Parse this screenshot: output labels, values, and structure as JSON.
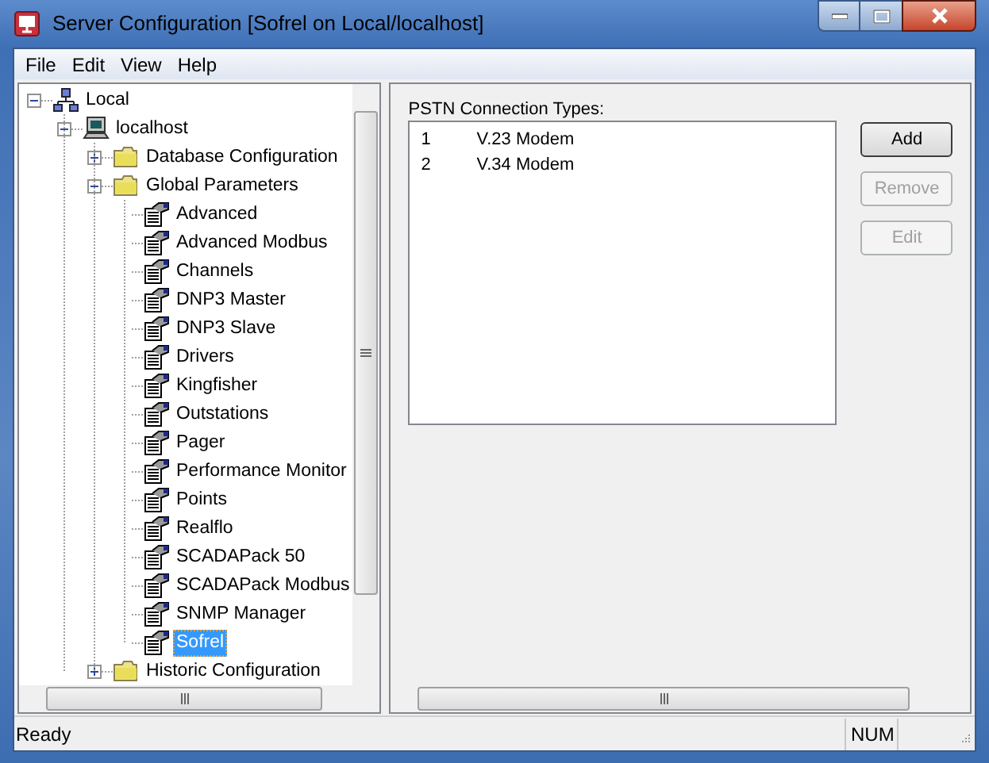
{
  "window": {
    "title": "Server Configuration [Sofrel on Local/localhost]"
  },
  "menu": [
    "File",
    "Edit",
    "View",
    "Help"
  ],
  "tree": [
    {
      "label": "Local",
      "kind": "network",
      "expanded": true,
      "selected": false,
      "children": [
        {
          "label": "localhost",
          "kind": "computer",
          "expanded": true,
          "selected": false,
          "children": [
            {
              "label": "Database Configuration",
              "kind": "folder",
              "expanded": false,
              "selected": false
            },
            {
              "label": "Global Parameters",
              "kind": "folder",
              "expanded": true,
              "selected": false,
              "children": [
                {
                  "label": "Advanced",
                  "kind": "page",
                  "selected": false
                },
                {
                  "label": "Advanced Modbus",
                  "kind": "page",
                  "selected": false
                },
                {
                  "label": "Channels",
                  "kind": "page",
                  "selected": false
                },
                {
                  "label": "DNP3 Master",
                  "kind": "page",
                  "selected": false
                },
                {
                  "label": "DNP3 Slave",
                  "kind": "page",
                  "selected": false
                },
                {
                  "label": "Drivers",
                  "kind": "page",
                  "selected": false
                },
                {
                  "label": "Kingfisher",
                  "kind": "page",
                  "selected": false
                },
                {
                  "label": "Outstations",
                  "kind": "page",
                  "selected": false
                },
                {
                  "label": "Pager",
                  "kind": "page",
                  "selected": false
                },
                {
                  "label": "Performance Monitor",
                  "kind": "page",
                  "selected": false
                },
                {
                  "label": "Points",
                  "kind": "page",
                  "selected": false
                },
                {
                  "label": "Realflo",
                  "kind": "page",
                  "selected": false
                },
                {
                  "label": "SCADAPack 50",
                  "kind": "page",
                  "selected": false
                },
                {
                  "label": "SCADAPack Modbus",
                  "kind": "page",
                  "selected": false
                },
                {
                  "label": "SNMP Manager",
                  "kind": "page",
                  "selected": false
                },
                {
                  "label": "Sofrel",
                  "kind": "page",
                  "selected": true
                }
              ]
            },
            {
              "label": "Historic Configuration",
              "kind": "folder",
              "expanded": false,
              "selected": false
            }
          ]
        }
      ]
    }
  ],
  "pstn": {
    "label": "PSTN Connection Types:",
    "rows": [
      {
        "number": "1",
        "name": "V.23 Modem"
      },
      {
        "number": "2",
        "name": "V.34 Modem"
      }
    ]
  },
  "buttons": [
    {
      "label": "Add",
      "disabled": false
    },
    {
      "label": "Remove",
      "disabled": true
    },
    {
      "label": "Edit",
      "disabled": true
    }
  ],
  "status_bar": {
    "text": "Ready",
    "indicator": "NUM"
  }
}
